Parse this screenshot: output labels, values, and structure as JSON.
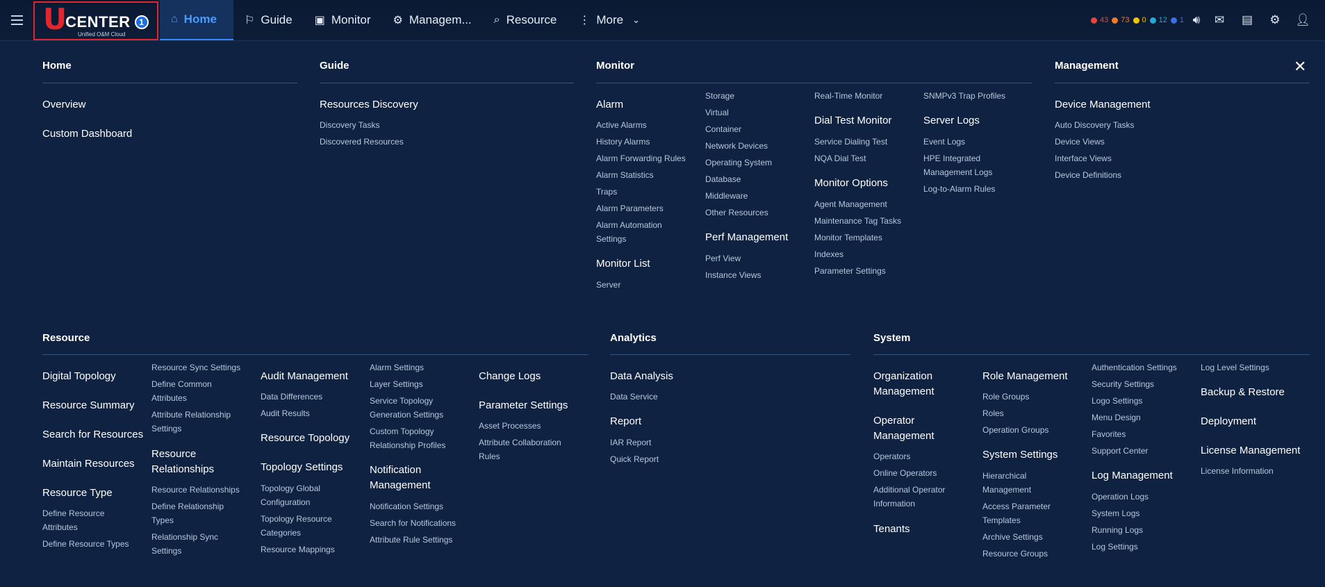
{
  "nav": {
    "logo_main": "CENTER",
    "logo_badge": "1",
    "logo_sub": "Unified O&M Cloud",
    "items": [
      {
        "label": "Home"
      },
      {
        "label": "Guide"
      },
      {
        "label": "Monitor"
      },
      {
        "label": "Managem..."
      },
      {
        "label": "Resource"
      },
      {
        "label": "More"
      }
    ]
  },
  "alarms": [
    {
      "count": "43",
      "color": "#e5463c"
    },
    {
      "count": "73",
      "color": "#f07c24"
    },
    {
      "count": "0",
      "color": "#f2c400"
    },
    {
      "count": "12",
      "color": "#27a9d8"
    },
    {
      "count": "1",
      "color": "#3a6fe8"
    }
  ],
  "toolbar_icons": [
    "alarm-sound-icon",
    "inbox-icon",
    "save-icon",
    "gear-icon",
    "user-icon"
  ],
  "sections": {
    "home": {
      "title": "Home",
      "items": [
        "Overview",
        "Custom Dashboard"
      ]
    },
    "guide": {
      "title": "Guide",
      "group": "Resources Discovery",
      "links": [
        "Discovery Tasks",
        "Discovered Resources"
      ]
    },
    "monitor": {
      "title": "Monitor",
      "alarm": {
        "title": "Alarm",
        "links": [
          "Active Alarms",
          "History Alarms",
          "Alarm Forwarding Rules",
          "Alarm Statistics",
          "Traps",
          "Alarm Parameters",
          "Alarm Automation",
          "Settings"
        ]
      },
      "monitor_list": {
        "title": "Monitor List",
        "links": [
          "Server"
        ]
      },
      "col2": {
        "links": [
          "Storage",
          "Virtual",
          "Container",
          "Network Devices",
          "Operating System",
          "Database",
          "Middleware",
          "Other Resources"
        ]
      },
      "perf": {
        "title": "Perf Management",
        "links": [
          "Perf View",
          "Instance Views"
        ]
      },
      "col3_top": {
        "links": [
          "Real-Time Monitor"
        ]
      },
      "dial": {
        "title": "Dial Test Monitor",
        "links": [
          "Service Dialing Test",
          "NQA Dial Test"
        ]
      },
      "options": {
        "title": "Monitor Options",
        "links": [
          "Agent Management",
          "Maintenance Tag Tasks",
          "Monitor Templates",
          "Indexes",
          "Parameter Settings"
        ]
      },
      "col4_top": {
        "links": [
          "SNMPv3 Trap Profiles"
        ]
      },
      "server_logs": {
        "title": "Server Logs",
        "links": [
          "Event Logs",
          "HPE Integrated",
          "Management Logs",
          "Log-to-Alarm Rules"
        ]
      }
    },
    "management": {
      "title": "Management",
      "group": "Device Management",
      "links": [
        "Auto Discovery Tasks",
        "Device Views",
        "Interface Views",
        "Device Definitions"
      ]
    },
    "resource": {
      "title": "Resource",
      "col1": {
        "headings": [
          "Digital Topology",
          "Resource Summary",
          "Search for Resources",
          "Maintain Resources",
          "Resource Type"
        ],
        "links": [
          "Define Resource",
          "Attributes",
          "Define Resource Types"
        ]
      },
      "col2": {
        "links_top": [
          "Resource Sync Settings",
          "Define Common",
          "Attributes",
          "Attribute Relationship",
          "Settings"
        ],
        "heading": [
          "Resource",
          "Relationships"
        ],
        "links": [
          "Resource Relationships",
          "Define Relationship",
          "Types",
          "Relationship Sync",
          "Settings"
        ]
      },
      "col3": {
        "audit": "Audit Management",
        "audit_links": [
          "Data Differences",
          "Audit Results"
        ],
        "topology": "Resource Topology",
        "topo_settings": "Topology Settings",
        "topo_links": [
          "Topology Global",
          "Configuration",
          "Topology Resource",
          "Categories",
          "Resource Mappings"
        ]
      },
      "col4": {
        "links_top": [
          "Alarm Settings",
          "Layer Settings",
          "Service Topology",
          "Generation Settings",
          "Custom Topology",
          "Relationship Profiles"
        ],
        "heading": [
          "Notification",
          "Management"
        ],
        "links": [
          "Notification Settings",
          "Search for Notifications",
          "Attribute Rule Settings"
        ]
      },
      "col5": {
        "change_logs": "Change Logs",
        "param": "Parameter Settings",
        "links": [
          "Asset Processes",
          "Attribute Collaboration",
          "Rules"
        ]
      }
    },
    "analytics": {
      "title": "Analytics",
      "data_analysis": "Data Analysis",
      "da_links": [
        "Data Service"
      ],
      "report": "Report",
      "report_links": [
        "IAR Report",
        "Quick Report"
      ]
    },
    "system": {
      "title": "System",
      "col1": {
        "org": [
          "Organization",
          "Management"
        ],
        "op": [
          "Operator",
          "Management"
        ],
        "links": [
          "Operators",
          "Online Operators",
          "Additional Operator",
          "Information"
        ],
        "tenants": "Tenants"
      },
      "col2": {
        "role": "Role Management",
        "role_links": [
          "Role Groups",
          "Roles",
          "Operation Groups"
        ],
        "sys": "System Settings",
        "sys_links": [
          "Hierarchical",
          "Management",
          "Access Parameter",
          "Templates",
          "Archive Settings",
          "Resource Groups"
        ]
      },
      "col3": {
        "links_top": [
          "Authentication Settings",
          "Security Settings",
          "Logo Settings",
          "Menu Design",
          "Favorites",
          "Support Center"
        ],
        "log": "Log Management",
        "log_links": [
          "Operation Logs",
          "System Logs",
          "Running Logs",
          "Log Settings"
        ]
      },
      "col4": {
        "links_top": [
          "Log Level Settings"
        ],
        "backup": "Backup & Restore",
        "deploy": "Deployment",
        "license": "License Management",
        "license_links": [
          "License Information"
        ]
      }
    }
  }
}
